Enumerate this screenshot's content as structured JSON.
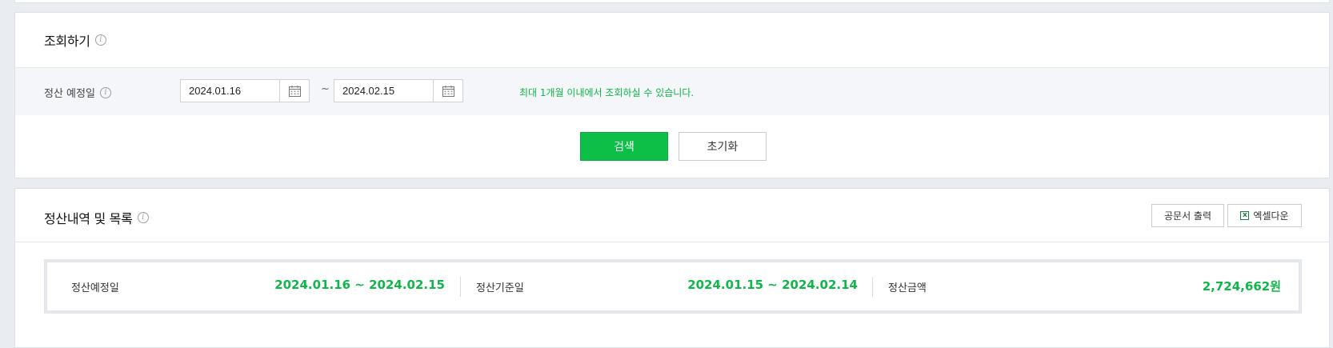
{
  "search": {
    "title": "조회하기",
    "date_label": "정산 예정일",
    "start_date": "2024.01.16",
    "end_date": "2024.02.15",
    "separator": "~",
    "hint": "최대 1개월 이내에서 조회하실 수 있습니다.",
    "search_button": "검색",
    "reset_button": "초기화"
  },
  "list": {
    "title": "정산내역 및 목록",
    "print_button": "공문서 출력",
    "excel_button": "엑셀다운",
    "summary": [
      {
        "label": "정산예정일",
        "value": "2024.01.16 ~ 2024.02.15"
      },
      {
        "label": "정산기준일",
        "value": "2024.01.15 ~ 2024.02.14"
      },
      {
        "label": "정산금액",
        "value": "2,724,662원"
      }
    ]
  },
  "colors": {
    "accent": "#0dbf46",
    "hint_text": "#0fb648"
  },
  "icons": [
    "info-icon",
    "calendar-icon",
    "excel-icon"
  ]
}
